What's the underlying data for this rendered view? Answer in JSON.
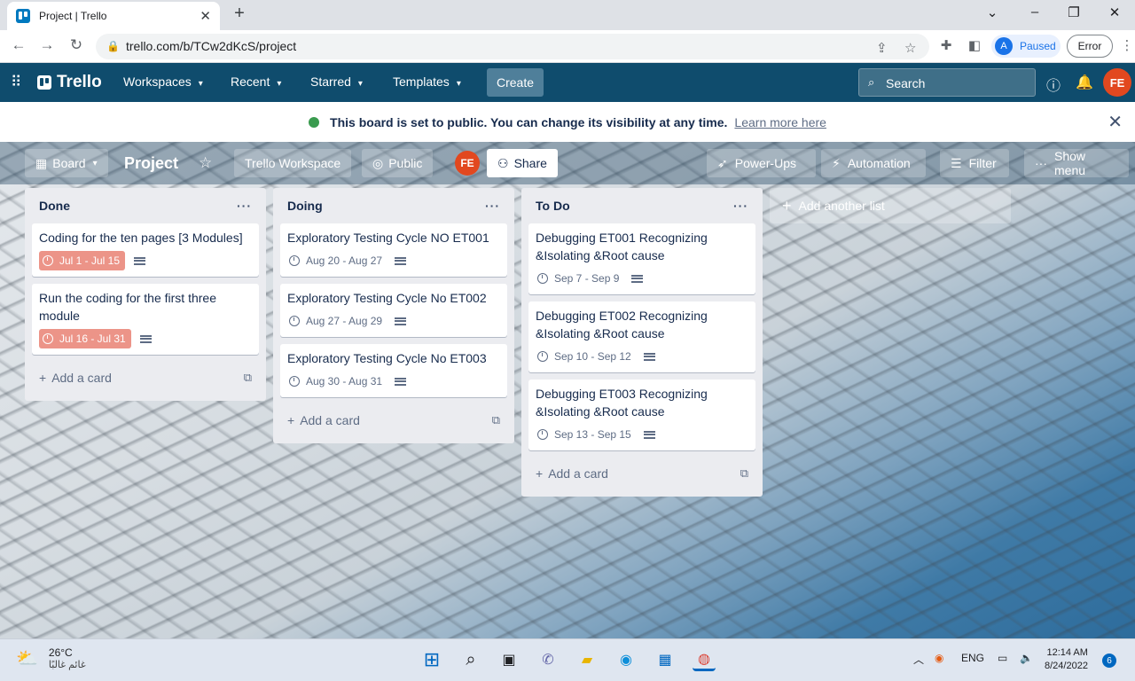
{
  "browser": {
    "tab_title": "Project | Trello",
    "url": "trello.com/b/TCw2dKcS/project",
    "profile_initial": "A",
    "profile_status": "Paused",
    "error_label": "Error"
  },
  "header": {
    "logo": "Trello",
    "menus": [
      "Workspaces",
      "Recent",
      "Starred",
      "Templates"
    ],
    "create_label": "Create",
    "search_placeholder": "Search",
    "user_initials": "FE"
  },
  "banner": {
    "text": "This board is set to public. You can change its visibility at any time.",
    "link": "Learn more here"
  },
  "board": {
    "view_label": "Board",
    "title": "Project",
    "workspace": "Trello Workspace",
    "visibility": "Public",
    "member_initials": "FE",
    "share_label": "Share",
    "power_ups": "Power-Ups",
    "automation": "Automation",
    "filter": "Filter",
    "show_menu": "Show menu",
    "add_list": "Add another list"
  },
  "lists": [
    {
      "title": "Done",
      "add_card": "Add a card",
      "cards": [
        {
          "title": "Coding for the ten pages [3 Modules]",
          "due": "Jul 1 - Jul 15",
          "overdue": true
        },
        {
          "title": "Run the coding for the first three module",
          "due": "Jul 16 - Jul 31",
          "overdue": true
        }
      ]
    },
    {
      "title": "Doing",
      "add_card": "Add a card",
      "cards": [
        {
          "title": "Exploratory Testing Cycle NO ET001",
          "due": "Aug 20 - Aug 27",
          "overdue": false
        },
        {
          "title": "Exploratory Testing Cycle No ET002",
          "due": "Aug 27 - Aug 29",
          "overdue": false
        },
        {
          "title": "Exploratory Testing Cycle No ET003",
          "due": "Aug 30 - Aug 31",
          "overdue": false
        }
      ]
    },
    {
      "title": "To Do",
      "add_card": "Add a card",
      "cards": [
        {
          "title": "Debugging ET001 Recognizing &Isolating &Root cause",
          "due": "Sep 7 - Sep 9",
          "overdue": false
        },
        {
          "title": "Debugging ET002 Recognizing &Isolating &Root cause",
          "due": "Sep 10 - Sep 12",
          "overdue": false
        },
        {
          "title": "Debugging ET003 Recognizing &Isolating &Root cause",
          "due": "Sep 13 - Sep 15",
          "overdue": false
        }
      ]
    }
  ],
  "taskbar": {
    "temperature": "26°C",
    "weather": "غائم غالبًا",
    "language": "ENG",
    "time": "12:14 AM",
    "date": "8/24/2022",
    "notifications": "6"
  },
  "colors": {
    "header_bg": "#0f4c6d",
    "overdue_badge": "#ec9488",
    "avatar": "#e2481f"
  }
}
